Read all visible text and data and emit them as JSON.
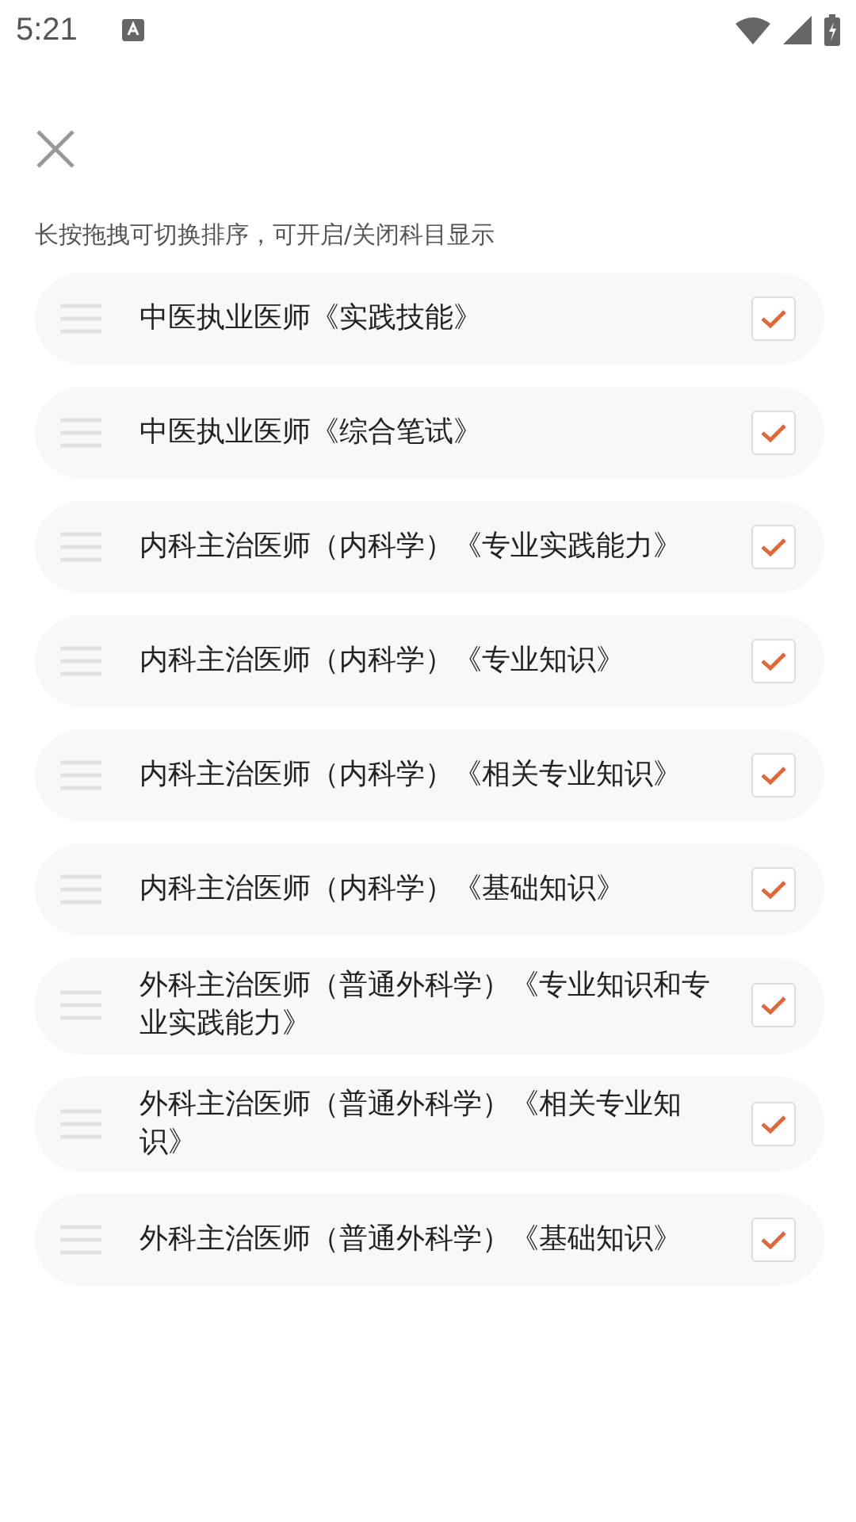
{
  "status_bar": {
    "time": "5:21"
  },
  "hint": "长按拖拽可切换排序，可开启/关闭科目显示",
  "subjects": [
    {
      "name": "中医执业医师《实践技能》",
      "checked": true
    },
    {
      "name": "中医执业医师《综合笔试》",
      "checked": true
    },
    {
      "name": "内科主治医师（内科学）《专业实践能力》",
      "checked": true
    },
    {
      "name": "内科主治医师（内科学）《专业知识》",
      "checked": true
    },
    {
      "name": "内科主治医师（内科学）《相关专业知识》",
      "checked": true
    },
    {
      "name": "内科主治医师（内科学）《基础知识》",
      "checked": true
    },
    {
      "name": "外科主治医师（普通外科学）《专业知识和专业实践能力》",
      "checked": true
    },
    {
      "name": "外科主治医师（普通外科学）《相关专业知识》",
      "checked": true
    },
    {
      "name": "外科主治医师（普通外科学）《基础知识》",
      "checked": true
    }
  ]
}
